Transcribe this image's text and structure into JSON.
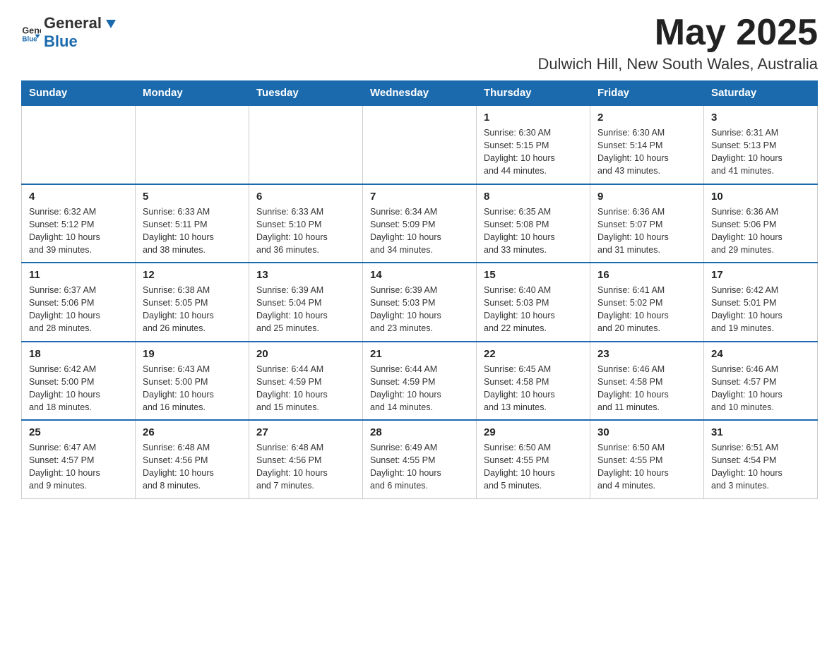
{
  "header": {
    "logo_general": "General",
    "logo_blue": "Blue",
    "month_title": "May 2025",
    "location": "Dulwich Hill, New South Wales, Australia"
  },
  "days_of_week": [
    "Sunday",
    "Monday",
    "Tuesday",
    "Wednesday",
    "Thursday",
    "Friday",
    "Saturday"
  ],
  "weeks": [
    [
      {
        "day": "",
        "info": ""
      },
      {
        "day": "",
        "info": ""
      },
      {
        "day": "",
        "info": ""
      },
      {
        "day": "",
        "info": ""
      },
      {
        "day": "1",
        "info": "Sunrise: 6:30 AM\nSunset: 5:15 PM\nDaylight: 10 hours\nand 44 minutes."
      },
      {
        "day": "2",
        "info": "Sunrise: 6:30 AM\nSunset: 5:14 PM\nDaylight: 10 hours\nand 43 minutes."
      },
      {
        "day": "3",
        "info": "Sunrise: 6:31 AM\nSunset: 5:13 PM\nDaylight: 10 hours\nand 41 minutes."
      }
    ],
    [
      {
        "day": "4",
        "info": "Sunrise: 6:32 AM\nSunset: 5:12 PM\nDaylight: 10 hours\nand 39 minutes."
      },
      {
        "day": "5",
        "info": "Sunrise: 6:33 AM\nSunset: 5:11 PM\nDaylight: 10 hours\nand 38 minutes."
      },
      {
        "day": "6",
        "info": "Sunrise: 6:33 AM\nSunset: 5:10 PM\nDaylight: 10 hours\nand 36 minutes."
      },
      {
        "day": "7",
        "info": "Sunrise: 6:34 AM\nSunset: 5:09 PM\nDaylight: 10 hours\nand 34 minutes."
      },
      {
        "day": "8",
        "info": "Sunrise: 6:35 AM\nSunset: 5:08 PM\nDaylight: 10 hours\nand 33 minutes."
      },
      {
        "day": "9",
        "info": "Sunrise: 6:36 AM\nSunset: 5:07 PM\nDaylight: 10 hours\nand 31 minutes."
      },
      {
        "day": "10",
        "info": "Sunrise: 6:36 AM\nSunset: 5:06 PM\nDaylight: 10 hours\nand 29 minutes."
      }
    ],
    [
      {
        "day": "11",
        "info": "Sunrise: 6:37 AM\nSunset: 5:06 PM\nDaylight: 10 hours\nand 28 minutes."
      },
      {
        "day": "12",
        "info": "Sunrise: 6:38 AM\nSunset: 5:05 PM\nDaylight: 10 hours\nand 26 minutes."
      },
      {
        "day": "13",
        "info": "Sunrise: 6:39 AM\nSunset: 5:04 PM\nDaylight: 10 hours\nand 25 minutes."
      },
      {
        "day": "14",
        "info": "Sunrise: 6:39 AM\nSunset: 5:03 PM\nDaylight: 10 hours\nand 23 minutes."
      },
      {
        "day": "15",
        "info": "Sunrise: 6:40 AM\nSunset: 5:03 PM\nDaylight: 10 hours\nand 22 minutes."
      },
      {
        "day": "16",
        "info": "Sunrise: 6:41 AM\nSunset: 5:02 PM\nDaylight: 10 hours\nand 20 minutes."
      },
      {
        "day": "17",
        "info": "Sunrise: 6:42 AM\nSunset: 5:01 PM\nDaylight: 10 hours\nand 19 minutes."
      }
    ],
    [
      {
        "day": "18",
        "info": "Sunrise: 6:42 AM\nSunset: 5:00 PM\nDaylight: 10 hours\nand 18 minutes."
      },
      {
        "day": "19",
        "info": "Sunrise: 6:43 AM\nSunset: 5:00 PM\nDaylight: 10 hours\nand 16 minutes."
      },
      {
        "day": "20",
        "info": "Sunrise: 6:44 AM\nSunset: 4:59 PM\nDaylight: 10 hours\nand 15 minutes."
      },
      {
        "day": "21",
        "info": "Sunrise: 6:44 AM\nSunset: 4:59 PM\nDaylight: 10 hours\nand 14 minutes."
      },
      {
        "day": "22",
        "info": "Sunrise: 6:45 AM\nSunset: 4:58 PM\nDaylight: 10 hours\nand 13 minutes."
      },
      {
        "day": "23",
        "info": "Sunrise: 6:46 AM\nSunset: 4:58 PM\nDaylight: 10 hours\nand 11 minutes."
      },
      {
        "day": "24",
        "info": "Sunrise: 6:46 AM\nSunset: 4:57 PM\nDaylight: 10 hours\nand 10 minutes."
      }
    ],
    [
      {
        "day": "25",
        "info": "Sunrise: 6:47 AM\nSunset: 4:57 PM\nDaylight: 10 hours\nand 9 minutes."
      },
      {
        "day": "26",
        "info": "Sunrise: 6:48 AM\nSunset: 4:56 PM\nDaylight: 10 hours\nand 8 minutes."
      },
      {
        "day": "27",
        "info": "Sunrise: 6:48 AM\nSunset: 4:56 PM\nDaylight: 10 hours\nand 7 minutes."
      },
      {
        "day": "28",
        "info": "Sunrise: 6:49 AM\nSunset: 4:55 PM\nDaylight: 10 hours\nand 6 minutes."
      },
      {
        "day": "29",
        "info": "Sunrise: 6:50 AM\nSunset: 4:55 PM\nDaylight: 10 hours\nand 5 minutes."
      },
      {
        "day": "30",
        "info": "Sunrise: 6:50 AM\nSunset: 4:55 PM\nDaylight: 10 hours\nand 4 minutes."
      },
      {
        "day": "31",
        "info": "Sunrise: 6:51 AM\nSunset: 4:54 PM\nDaylight: 10 hours\nand 3 minutes."
      }
    ]
  ]
}
